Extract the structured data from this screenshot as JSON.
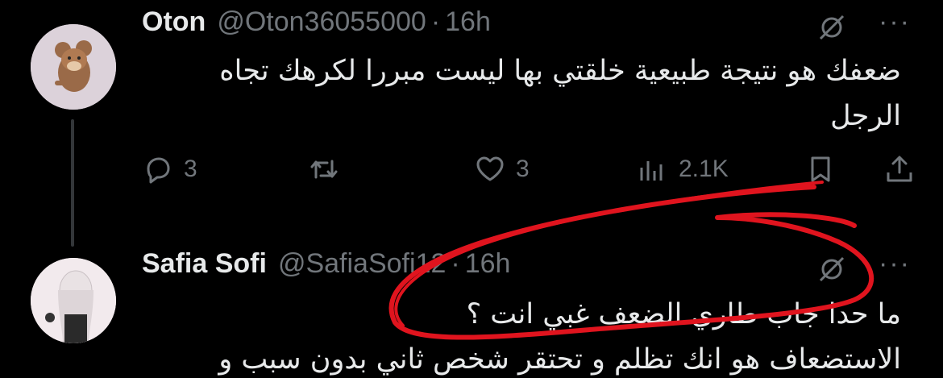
{
  "tweet1": {
    "name": "Oton",
    "handle": "@Oton36055000",
    "separator": "·",
    "time": "16h",
    "text": "ضعفك هو نتيجة طبيعية خلقتي بها ليست مبررا لكرهك تجاه الرجل",
    "replies": "3",
    "likes": "3",
    "views": "2.1K",
    "more": "···"
  },
  "tweet2": {
    "name": "Safia Sofi",
    "handle": "@SafiaSofi12",
    "separator": "·",
    "time": "16h",
    "line1": "ما حدا جاب طاري الضعف غبي انت ؟",
    "line2": "الاستضعاف هو انك تظلم و تحتقر شخص ثاني بدون سبب و",
    "more": "···"
  },
  "colors": {
    "background": "#000000",
    "text": "#e7e9ea",
    "muted": "#71767b",
    "annotation": "#e0141e"
  },
  "icons": [
    "reply-icon",
    "retweet-icon",
    "like-icon",
    "views-icon",
    "bookmark-icon",
    "share-icon",
    "grok-icon",
    "more-icon"
  ]
}
